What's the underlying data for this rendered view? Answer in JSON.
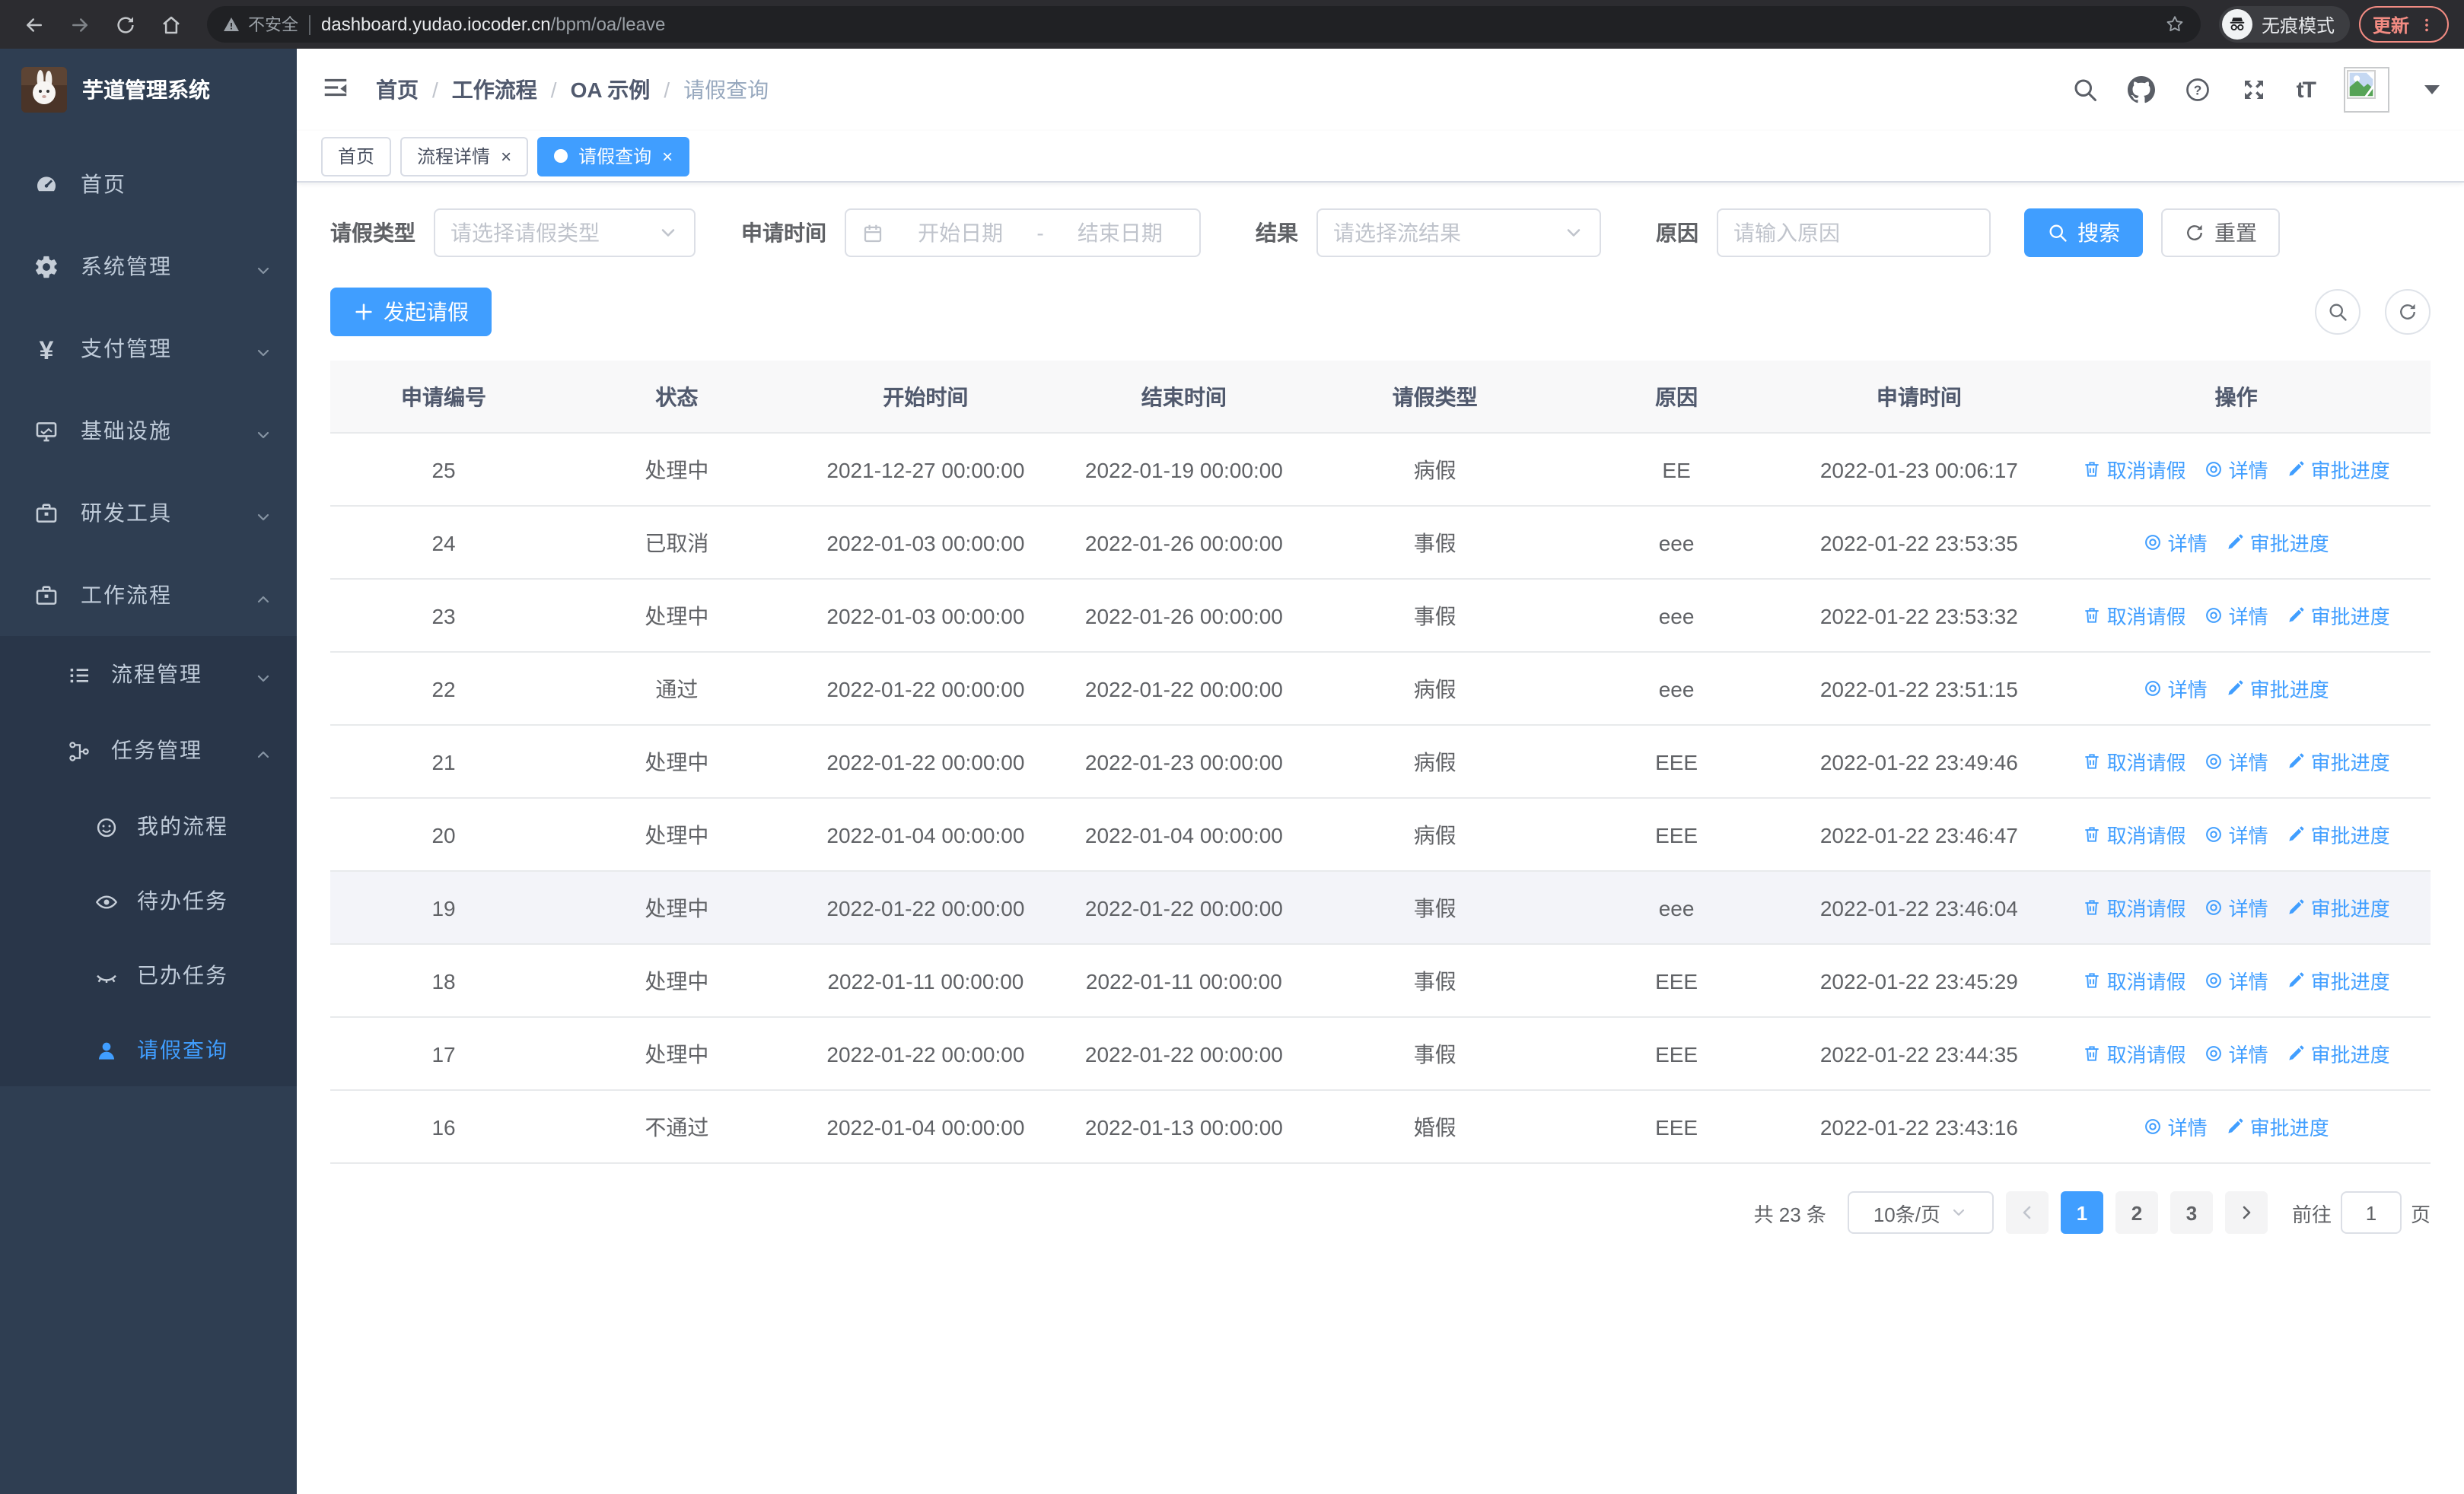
{
  "colors": {
    "accent": "#409eff",
    "sidebar_bg": "#2f3e52",
    "submenu_bg": "#293649",
    "update_pill": "#f28b82",
    "table_header_bg": "#f8f8f9",
    "row_highlight": "#f3f4f9"
  },
  "glyphs": {
    "slash": "/",
    "close": "×",
    "yen": "¥",
    "fontsize": "tT",
    "range_sep": "-"
  },
  "browser": {
    "security_label": "不安全",
    "url_host": "dashboard.yudao.iocoder.cn",
    "url_path": "/bpm/oa/leave",
    "incognito_label": "无痕模式",
    "update_label": "更新",
    "icons": [
      "back-icon",
      "forward-icon",
      "reload-icon",
      "home-icon",
      "warning-icon",
      "star-icon",
      "incognito-icon",
      "more-menu-icon"
    ]
  },
  "sidebar": {
    "title": "芋道管理系统",
    "logo_icon": "rabbit-avatar",
    "items": [
      {
        "label": "首页",
        "icon": "dashboard-icon"
      },
      {
        "label": "系统管理",
        "icon": "gear-icon",
        "state": "collapsed"
      },
      {
        "label": "支付管理",
        "icon": "yen-icon",
        "state": "collapsed"
      },
      {
        "label": "基础设施",
        "icon": "monitor-icon",
        "state": "collapsed"
      },
      {
        "label": "研发工具",
        "icon": "toolbox-icon",
        "state": "collapsed"
      },
      {
        "label": "工作流程",
        "icon": "briefcase-icon",
        "state": "expanded"
      }
    ],
    "submenu": [
      {
        "label": "流程管理",
        "icon": "flow-list-icon",
        "state": "collapsed"
      },
      {
        "label": "任务管理",
        "icon": "task-tree-icon",
        "state": "expanded"
      }
    ],
    "tasks_children": [
      {
        "label": "我的流程",
        "icon": "face-icon"
      },
      {
        "label": "待办任务",
        "icon": "eye-open-icon"
      },
      {
        "label": "已办任务",
        "icon": "eye-closed-icon"
      },
      {
        "label": "请假查询",
        "icon": "user-icon",
        "active": true
      }
    ]
  },
  "header": {
    "breadcrumb": [
      "首页",
      "工作流程",
      "OA 示例",
      "请假查询"
    ],
    "icons": [
      "fold-icon",
      "search-icon",
      "github-icon",
      "help-icon",
      "fullscreen-icon",
      "fontsize-icon",
      "avatar-placeholder",
      "caret-down-icon"
    ]
  },
  "tabs": [
    {
      "label": "首页",
      "closable": false,
      "active": false
    },
    {
      "label": "流程详情",
      "closable": true,
      "active": false
    },
    {
      "label": "请假查询",
      "closable": true,
      "active": true
    }
  ],
  "filters": {
    "type_label": "请假类型",
    "type_placeholder": "请选择请假类型",
    "time_label": "申请时间",
    "start_placeholder": "开始日期",
    "end_placeholder": "结束日期",
    "result_label": "结果",
    "result_placeholder": "请选择流结果",
    "reason_label": "原因",
    "reason_placeholder": "请输入原因",
    "search_label": "搜索",
    "reset_label": "重置"
  },
  "toolbar": {
    "create_label": "发起请假",
    "icons": [
      "search-toggle-icon",
      "refresh-icon"
    ]
  },
  "table": {
    "headers": [
      "申请编号",
      "状态",
      "开始时间",
      "结束时间",
      "请假类型",
      "原因",
      "申请时间",
      "操作"
    ],
    "actions": {
      "cancel": "取消请假",
      "detail": "详情",
      "progress": "审批进度"
    },
    "action_icons": [
      "delete-icon",
      "view-icon",
      "edit-pen-icon"
    ],
    "rows": [
      {
        "id": "25",
        "status": "处理中",
        "start": "2021-12-27 00:00:00",
        "end": "2022-01-19 00:00:00",
        "type": "病假",
        "reason": "EE",
        "applied": "2022-01-23 00:06:17",
        "can_cancel": true
      },
      {
        "id": "24",
        "status": "已取消",
        "start": "2022-01-03 00:00:00",
        "end": "2022-01-26 00:00:00",
        "type": "事假",
        "reason": "eee",
        "applied": "2022-01-22 23:53:35",
        "can_cancel": false
      },
      {
        "id": "23",
        "status": "处理中",
        "start": "2022-01-03 00:00:00",
        "end": "2022-01-26 00:00:00",
        "type": "事假",
        "reason": "eee",
        "applied": "2022-01-22 23:53:32",
        "can_cancel": true
      },
      {
        "id": "22",
        "status": "通过",
        "start": "2022-01-22 00:00:00",
        "end": "2022-01-22 00:00:00",
        "type": "病假",
        "reason": "eee",
        "applied": "2022-01-22 23:51:15",
        "can_cancel": false
      },
      {
        "id": "21",
        "status": "处理中",
        "start": "2022-01-22 00:00:00",
        "end": "2022-01-23 00:00:00",
        "type": "病假",
        "reason": "EEE",
        "applied": "2022-01-22 23:49:46",
        "can_cancel": true
      },
      {
        "id": "20",
        "status": "处理中",
        "start": "2022-01-04 00:00:00",
        "end": "2022-01-04 00:00:00",
        "type": "病假",
        "reason": "EEE",
        "applied": "2022-01-22 23:46:47",
        "can_cancel": true
      },
      {
        "id": "19",
        "status": "处理中",
        "start": "2022-01-22 00:00:00",
        "end": "2022-01-22 00:00:00",
        "type": "事假",
        "reason": "eee",
        "applied": "2022-01-22 23:46:04",
        "can_cancel": true
      },
      {
        "id": "18",
        "status": "处理中",
        "start": "2022-01-11 00:00:00",
        "end": "2022-01-11 00:00:00",
        "type": "事假",
        "reason": "EEE",
        "applied": "2022-01-22 23:45:29",
        "can_cancel": true
      },
      {
        "id": "17",
        "status": "处理中",
        "start": "2022-01-22 00:00:00",
        "end": "2022-01-22 00:00:00",
        "type": "事假",
        "reason": "EEE",
        "applied": "2022-01-22 23:44:35",
        "can_cancel": true
      },
      {
        "id": "16",
        "status": "不通过",
        "start": "2022-01-04 00:00:00",
        "end": "2022-01-13 00:00:00",
        "type": "婚假",
        "reason": "EEE",
        "applied": "2022-01-22 23:43:16",
        "can_cancel": false
      }
    ]
  },
  "pagination": {
    "total_label": "共 23 条",
    "page_size": "10条/页",
    "pages": [
      "1",
      "2",
      "3"
    ],
    "active_page": "1",
    "goto_label": "前往",
    "goto_value": "1",
    "unit_label": "页"
  }
}
